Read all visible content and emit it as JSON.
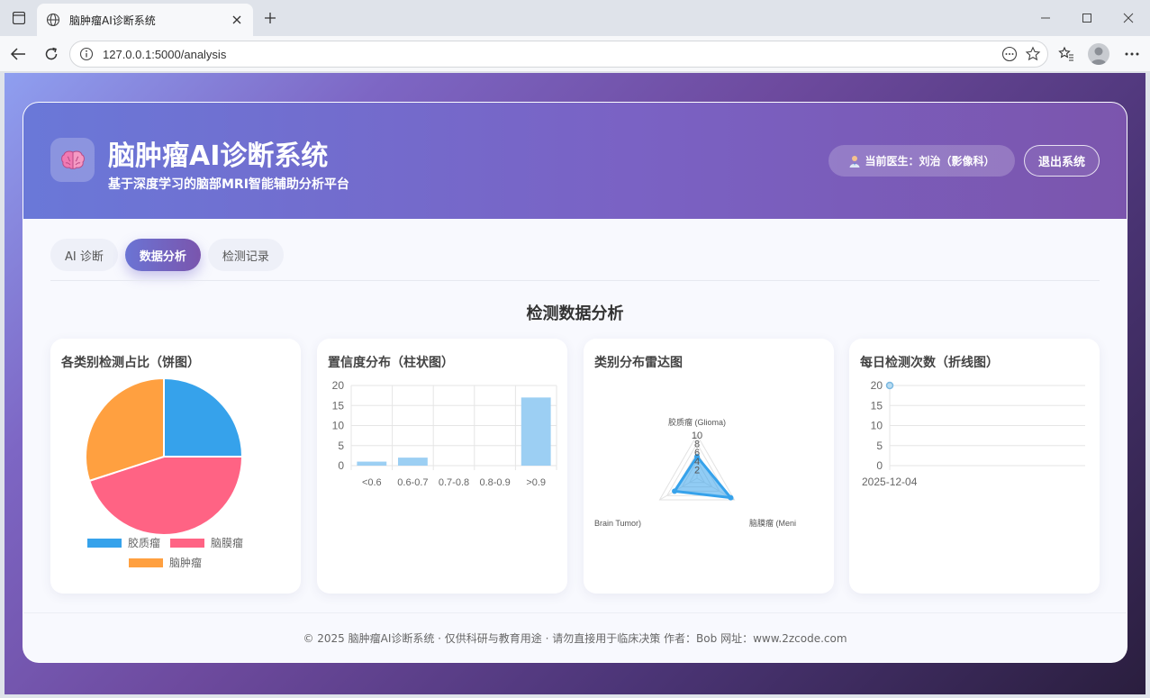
{
  "browser": {
    "tab_title": "脑肿瘤AI诊断系统",
    "url": "127.0.0.1:5000/analysis"
  },
  "header": {
    "logo_icon": "brain-icon",
    "title": "脑肿瘤AI诊断系统",
    "subtitle": "基于深度学习的脑部MRI智能辅助分析平台",
    "doctor_label": "当前医生：刘治（影像科）",
    "logout_label": "退出系统"
  },
  "tabs": [
    {
      "label": "AI 诊断",
      "active": false
    },
    {
      "label": "数据分析",
      "active": true
    },
    {
      "label": "检测记录",
      "active": false
    }
  ],
  "section_title": "检测数据分析",
  "panels": {
    "pie_title": "各类别检测占比（饼图）",
    "bar_title": "置信度分布（柱状图）",
    "radar_title": "类别分布雷达图",
    "line_title": "每日检测次数（折线图）"
  },
  "chart_data": [
    {
      "type": "pie",
      "title": "各类别检测占比（饼图）",
      "categories": [
        "胶质瘤",
        "脑膜瘤",
        "脑肿瘤"
      ],
      "values": [
        5,
        9,
        6
      ],
      "colors": [
        "#36a2eb",
        "#ff6384",
        "#ffa040"
      ],
      "legend": "bottom"
    },
    {
      "type": "bar",
      "title": "置信度分布（柱状图）",
      "categories": [
        "<0.6",
        "0.6-0.7",
        "0.7-0.8",
        "0.8-0.9",
        ">0.9"
      ],
      "values": [
        1,
        2,
        0,
        0,
        17
      ],
      "ylim": [
        0,
        20
      ],
      "yticks": [
        0,
        5,
        10,
        15,
        20
      ],
      "color": "#9ccff3",
      "grid": true
    },
    {
      "type": "radar",
      "title": "类别分布雷达图",
      "categories": [
        "胶质瘤 (Glioma)",
        "脑膜瘤 (Meni",
        "Brain Tumor)"
      ],
      "values": [
        5,
        9,
        6
      ],
      "rticks": [
        2,
        4,
        6,
        8,
        10
      ],
      "rmax": 10,
      "color": "#36a2eb"
    },
    {
      "type": "line",
      "title": "每日检测次数（折线图）",
      "x": [
        "2025-12-04"
      ],
      "values": [
        20
      ],
      "ylim": [
        0,
        20
      ],
      "yticks": [
        0,
        5,
        10,
        15,
        20
      ],
      "color": "#7ab8e0",
      "grid": true
    }
  ],
  "footer": "© 2025 脑肿瘤AI诊断系统 · 仅供科研与教育用途 · 请勿直接用于临床决策 作者：Bob 网址：www.2zcode.com"
}
